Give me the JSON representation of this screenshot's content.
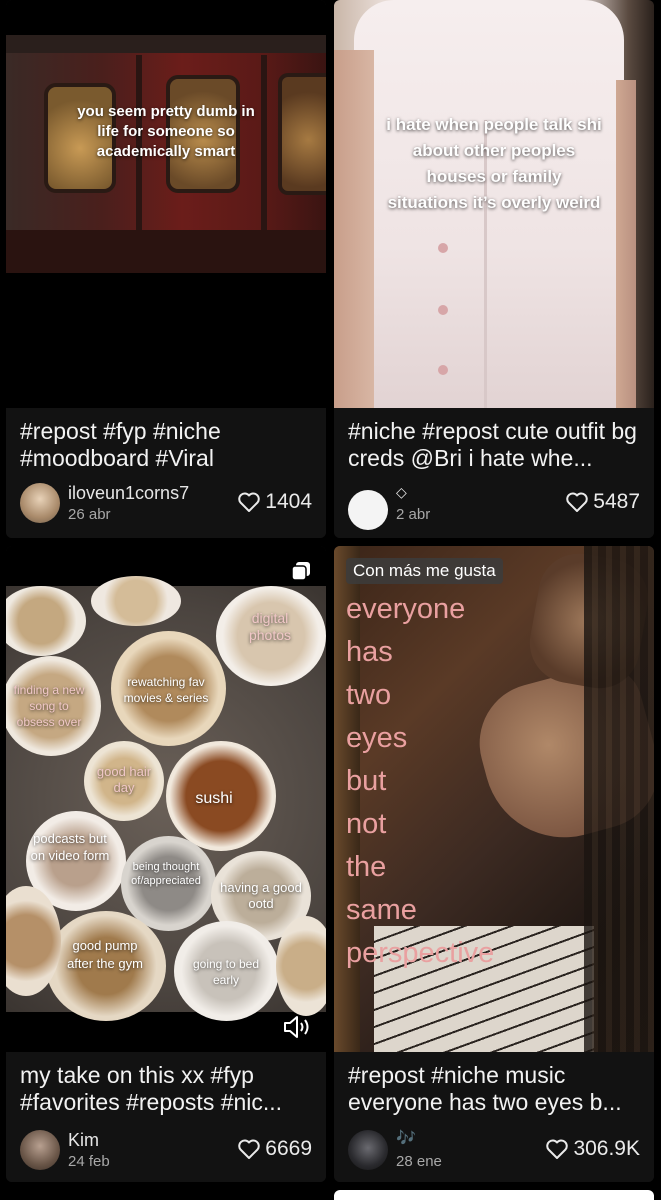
{
  "cards": [
    {
      "overlay": "you seem pretty dumb in life for someone so academically smart",
      "caption": "#repost #fyp #niche #moodboard #Viral",
      "user": "iloveun1corns7",
      "date": "26 abr",
      "likes": "1404"
    },
    {
      "overlay": "i hate when people talk shi about other peoples houses or family situations it’s overly weird",
      "caption": "#niche #repost cute outfit bg creds @Bri i hate whe...",
      "user": "◇",
      "date": "2 abr",
      "likes": "5487"
    },
    {
      "bubbles": [
        "digital photos",
        "finding a new song to obsess over",
        "rewatching fav movies & series",
        "good hair day",
        "sushi",
        "podcasts but on video form",
        "being thought of/appreciated",
        "having a good ootd",
        "good pump after the gym",
        "going to bed early"
      ],
      "caption": "my take on this xx #fyp #favorites #reposts #nic...",
      "user": "Kim",
      "date": "24 feb",
      "likes": "6669"
    },
    {
      "badge": "Con más me gusta",
      "overlay_lines": [
        "everyone",
        "has",
        "two",
        "eyes",
        "but",
        "not",
        "the",
        "same",
        "perspective"
      ],
      "caption": "#repost #niche music everyone has two eyes b...",
      "user": "🎶",
      "date": "28 ene",
      "likes": "306.9K"
    }
  ],
  "icons": {
    "heart": "heart-icon",
    "multi_photo": "multi-photo-icon",
    "sound": "sound-on-icon"
  },
  "colors": {
    "background": "#000000",
    "card": "#121212",
    "pink_text": "#e9a0a0"
  }
}
